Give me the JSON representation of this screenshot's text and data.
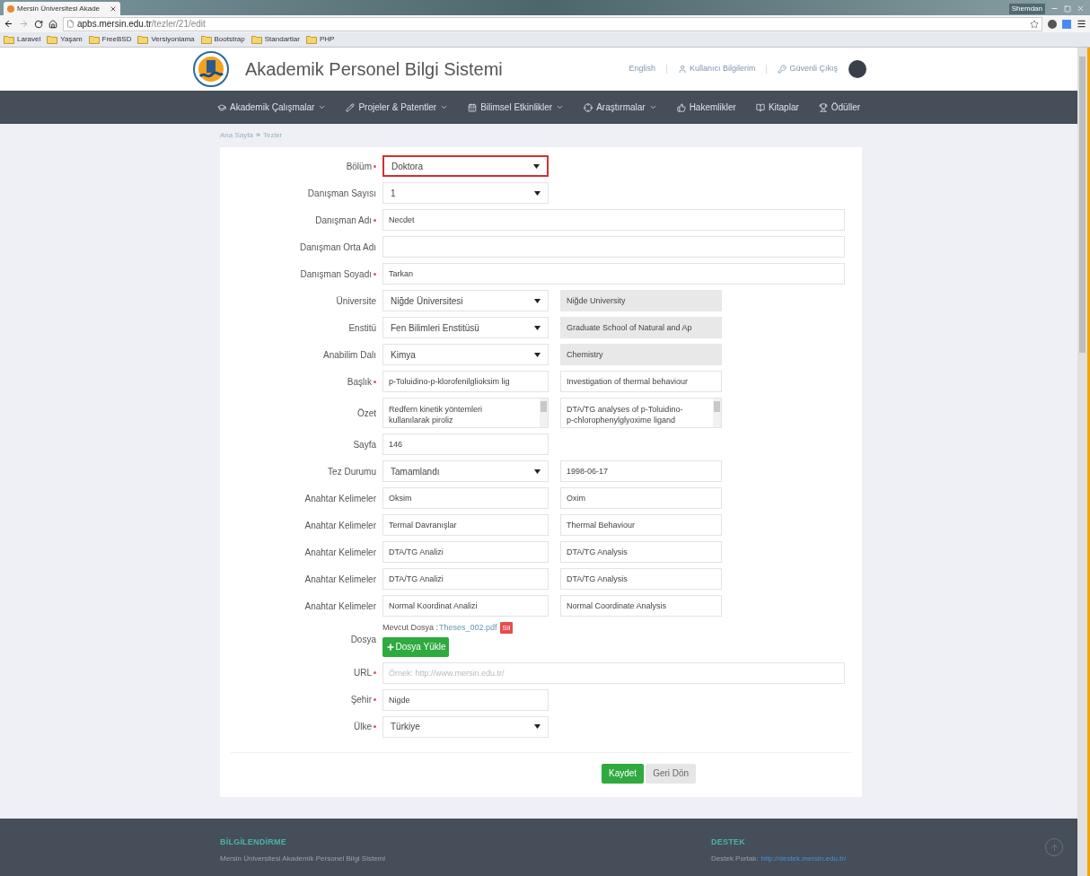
{
  "browser": {
    "tab_title": "Mersin Üniversitesi Akade",
    "user": "Shemdan",
    "url_host": "apbs.mersin.edu.tr",
    "url_path": "/tezler/21/edit",
    "bookmarks": [
      "Laravel",
      "Yaşam",
      "FreeBSD",
      "Versiyonlama",
      "Bootstrap",
      "Standartlar",
      "PHP"
    ]
  },
  "header": {
    "title": "Akademik Personel Bilgi Sistemi",
    "links": [
      {
        "kind": "plain",
        "label": "English"
      },
      {
        "kind": "user",
        "label": "Kullanıcı Bilgilerim"
      },
      {
        "kind": "key",
        "label": "Güvenli Çıkış"
      }
    ]
  },
  "nav": [
    {
      "label": "Akademik Çalışmalar",
      "has_dropdown": true
    },
    {
      "label": "Projeler & Patentler",
      "has_dropdown": true
    },
    {
      "label": "Bilimsel Etkinlikler",
      "has_dropdown": true
    },
    {
      "label": "Araştırmalar",
      "has_dropdown": true
    },
    {
      "label": "Hakemlikler",
      "has_dropdown": false
    },
    {
      "label": "Kitaplar",
      "has_dropdown": false
    },
    {
      "label": "Ödüller",
      "has_dropdown": false
    }
  ],
  "breadcrumb": [
    "Ana Sayfa",
    "Tezler"
  ],
  "breadcrumb_separator": "»",
  "form": {
    "rows": [
      {
        "label": "Bölüm",
        "required": true,
        "kind": "select",
        "value": "Doktora",
        "highlighted": true
      },
      {
        "label": "Danışman Sayısı",
        "required": false,
        "kind": "select",
        "value": "1",
        "highlighted": false
      },
      {
        "label": "Danışman Adı",
        "required": true,
        "kind": "wide_input",
        "value": "Necdet"
      },
      {
        "label": "Danışman Orta Adı",
        "required": false,
        "kind": "wide_input"
      },
      {
        "label": "Danışman Soyadı",
        "required": true,
        "kind": "wide_input",
        "value": "Tarkan"
      },
      {
        "label": "Üniversite",
        "required": false,
        "kind": "select",
        "value": "Niğde Üniversitesi",
        "highlighted": false,
        "second": {
          "kind": "input",
          "value": "Niğde University",
          "disabled": true
        }
      },
      {
        "label": "Enstitü",
        "required": false,
        "kind": "select",
        "value": "Fen Bilimleri Enstitüsü",
        "highlighted": false,
        "second": {
          "kind": "input",
          "value": "Graduate School of Natural and Ap",
          "disabled": true
        }
      },
      {
        "label": "Anabilim Dalı",
        "required": false,
        "kind": "select",
        "value": "Kimya",
        "highlighted": false,
        "second": {
          "kind": "input",
          "value": "Chemistry",
          "disabled": true
        }
      },
      {
        "label": "Başlık",
        "required": true,
        "kind": "input",
        "value": "p-Toluidino-p-klorofenilglioksim lig",
        "second": {
          "kind": "input",
          "value": "Investigation of thermal behaviour",
          "disabled": false
        }
      },
      {
        "label": "Özet",
        "required": false,
        "kind": "textarea",
        "lines": [
          "Redfern kinetik yöntemleri",
          "kullanılarak piroliz"
        ],
        "second": {
          "kind": "textarea",
          "lines": [
            "DTA/TG analyses of p-Toluidino-",
            "p-chlorophenylglyoxime ligand"
          ]
        }
      },
      {
        "label": "Sayfa",
        "required": false,
        "kind": "input",
        "value": "146"
      },
      {
        "label": "Tez Durumu",
        "required": false,
        "kind": "select",
        "value": "Tamamlandı",
        "highlighted": false,
        "second": {
          "kind": "input",
          "value": "1998-06-17",
          "disabled": false
        }
      },
      {
        "label": "Anahtar Kelimeler",
        "required": false,
        "kind": "input",
        "value": "Oksim",
        "second": {
          "kind": "input",
          "value": "Oxim",
          "disabled": false
        }
      },
      {
        "label": "Anahtar Kelimeler",
        "required": false,
        "kind": "input",
        "value": "Termal Davranışlar",
        "second": {
          "kind": "input",
          "value": "Thermal Behaviour",
          "disabled": false
        }
      },
      {
        "label": "Anahtar Kelimeler",
        "required": false,
        "kind": "input",
        "value": "DTA/TG Analizi",
        "second": {
          "kind": "input",
          "value": "DTA/TG Analysis",
          "disabled": false
        }
      },
      {
        "label": "Anahtar Kelimeler",
        "required": false,
        "kind": "input",
        "value": "DTA/TG Analizi",
        "second": {
          "kind": "input",
          "value": "DTA/TG Analysis",
          "disabled": false
        }
      },
      {
        "label": "Anahtar Kelimeler",
        "required": false,
        "kind": "input",
        "value": "Normal Koordinat Analizi",
        "second": {
          "kind": "input",
          "value": "Normal Coordinate Analysis",
          "disabled": false
        }
      },
      {
        "label": "Dosya",
        "required": false,
        "kind": "file",
        "current_label": "Mevcut Dosya :",
        "file_name": "Theses_002.pdf",
        "delete_label": "Sil",
        "upload_label": "Dosya Yükle"
      },
      {
        "label": "URL",
        "required": true,
        "kind": "wide_input",
        "placeholder": "Örnek: http://www.mersin.edu.tr/"
      },
      {
        "label": "Şehir",
        "required": true,
        "kind": "input",
        "value": "Nigde"
      },
      {
        "label": "Ülke",
        "required": true,
        "kind": "select",
        "value": "Türkiye",
        "highlighted": false
      }
    ],
    "buttons": [
      {
        "kind": "primary",
        "label": "Kaydet"
      },
      {
        "kind": "default",
        "label": "Geri Dön"
      }
    ]
  },
  "footer": {
    "info_title": "BİLGİLENDİRME",
    "info_text": "Mersin Üniversitesi Akademik Personel Bilgi Sistemi",
    "support_title": "DESTEK",
    "support_label": "Destek Portalı:",
    "support_link": "http://destek.mersin.edu.tr/"
  }
}
